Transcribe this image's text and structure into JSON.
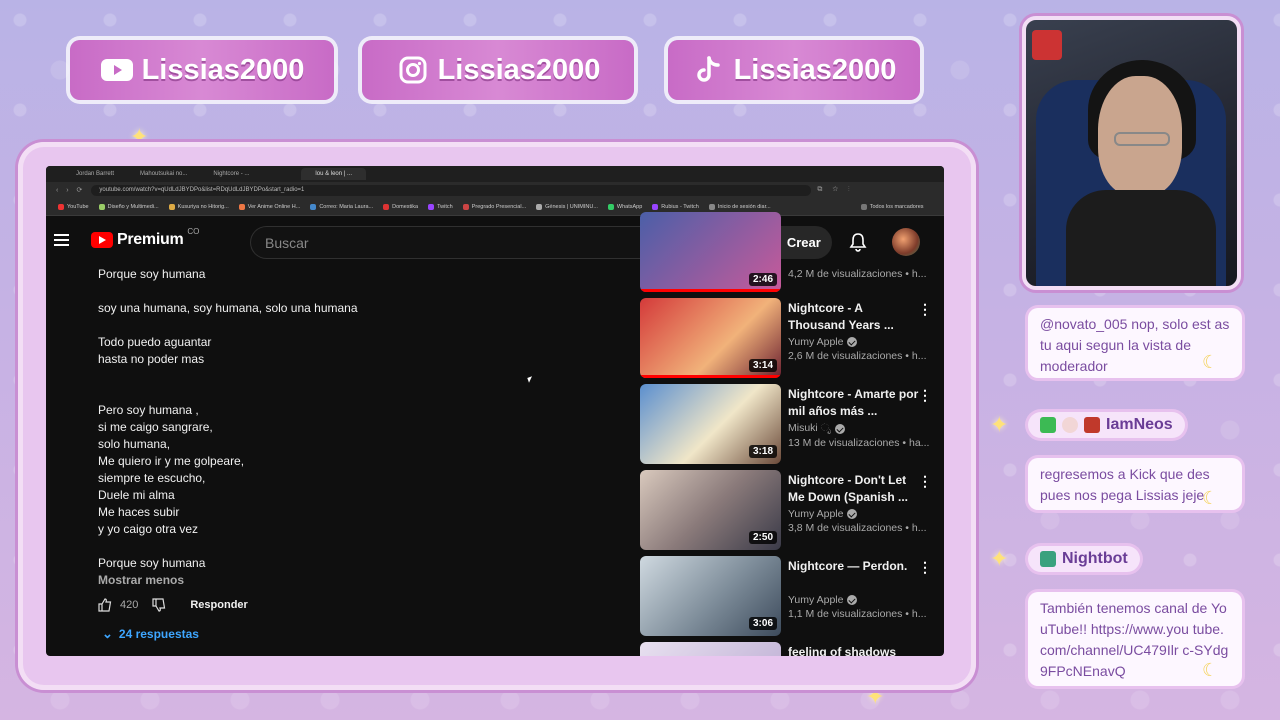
{
  "banners": {
    "youtube": "Lissias2000",
    "instagram": "Lissias2000",
    "tiktok": "Lissias2000"
  },
  "browser": {
    "tabs": [
      "Jordan Barrett",
      "Mahoutsukai no...",
      "Nightcore - ...",
      "",
      "lou & leon | ..."
    ],
    "url": "youtube.com/watch?v=qUdLdJBYDPo&list=RDqUdLdJBYDPo&start_radio=1",
    "bookmarks": [
      "YouTube",
      "Diseño y Multimedi...",
      "Kusuriya no Hitorig...",
      "Ver Anime Online H...",
      "Correo: Maria Laura...",
      "Domestika",
      "Twitch",
      "Pregrado Presencial...",
      "Génesis | UNIMINU...",
      "WhatsApp",
      "Rubius - Twitch",
      "Inicio de sesión diar..."
    ],
    "bookmarks_all": "Todos los marcadores"
  },
  "youtube": {
    "logo_text": "Premium",
    "country": "CO",
    "search_placeholder": "Buscar",
    "create_label": "Crear"
  },
  "comment": {
    "paragraphs": [
      "Porque soy humana",
      "soy una humana, soy humana, solo una humana",
      "Todo puedo aguantar\nhasta no poder mas",
      "Pero soy humana ,\nsi me caigo sangrare,\nsolo humana,\nMe quiero ir y me golpeare,\nsiempre te escucho,\nDuele mi alma\nMe haces subir\ny yo caigo otra vez",
      "Porque soy humana"
    ],
    "show_less": "Mostrar menos",
    "likes": "420",
    "reply": "Responder",
    "replies": "24 respuestas"
  },
  "videos": [
    {
      "title": "",
      "channel": "",
      "views": "4,2 M de visualizaciones • h...",
      "duration": "2:46",
      "colors": [
        "#4b5fa8",
        "#c85a9a"
      ]
    },
    {
      "title": "Nightcore - A Thousand Years ...",
      "channel": "Yumy Apple",
      "views": "2,6 M de visualizaciones • h...",
      "duration": "3:14",
      "colors": [
        "#d43a3a",
        "#f1b27a"
      ]
    },
    {
      "title": "Nightcore - Amarte por mil años más ...",
      "channel": "Misuki ೃ",
      "views": "13 M de visualizaciones • ha...",
      "duration": "3:18",
      "colors": [
        "#5b8fcf",
        "#f0e6c8"
      ]
    },
    {
      "title": "Nightcore - Don't Let Me Down (Spanish ...",
      "channel": "Yumy Apple",
      "views": "3,8 M de visualizaciones • h...",
      "duration": "2:50",
      "colors": [
        "#d9c9bd",
        "#3a3a48"
      ]
    },
    {
      "title": "Nightcore — Perdon.",
      "channel": "Yumy Apple",
      "views": "1,1 M de visualizaciones • h...",
      "duration": "3:06",
      "colors": [
        "#cfd9e0",
        "#3d4b5c"
      ]
    },
    {
      "title": "feeling of shadows",
      "channel": "",
      "views": "",
      "duration": "",
      "colors": [
        "#e8e0f0",
        "#b8a8d0"
      ]
    }
  ],
  "chat": {
    "msg1": "@novato_005 nop, solo est as tu aqui segun la vista de moderador",
    "user2": "IamNeos",
    "msg2": "regresemos a Kick que des pues nos pega Lissias jeje",
    "user3": "Nightbot",
    "msg3": "También tenemos canal de YouTube!! https://www.you tube.com/channel/UC479Ilr c-SYdg9FPcNEnavQ"
  },
  "colors": {
    "accent_red": "#ff0000",
    "link_blue": "#3ea6ff",
    "chat_text": "#7a4ca0",
    "banner": "#c86bc6"
  }
}
